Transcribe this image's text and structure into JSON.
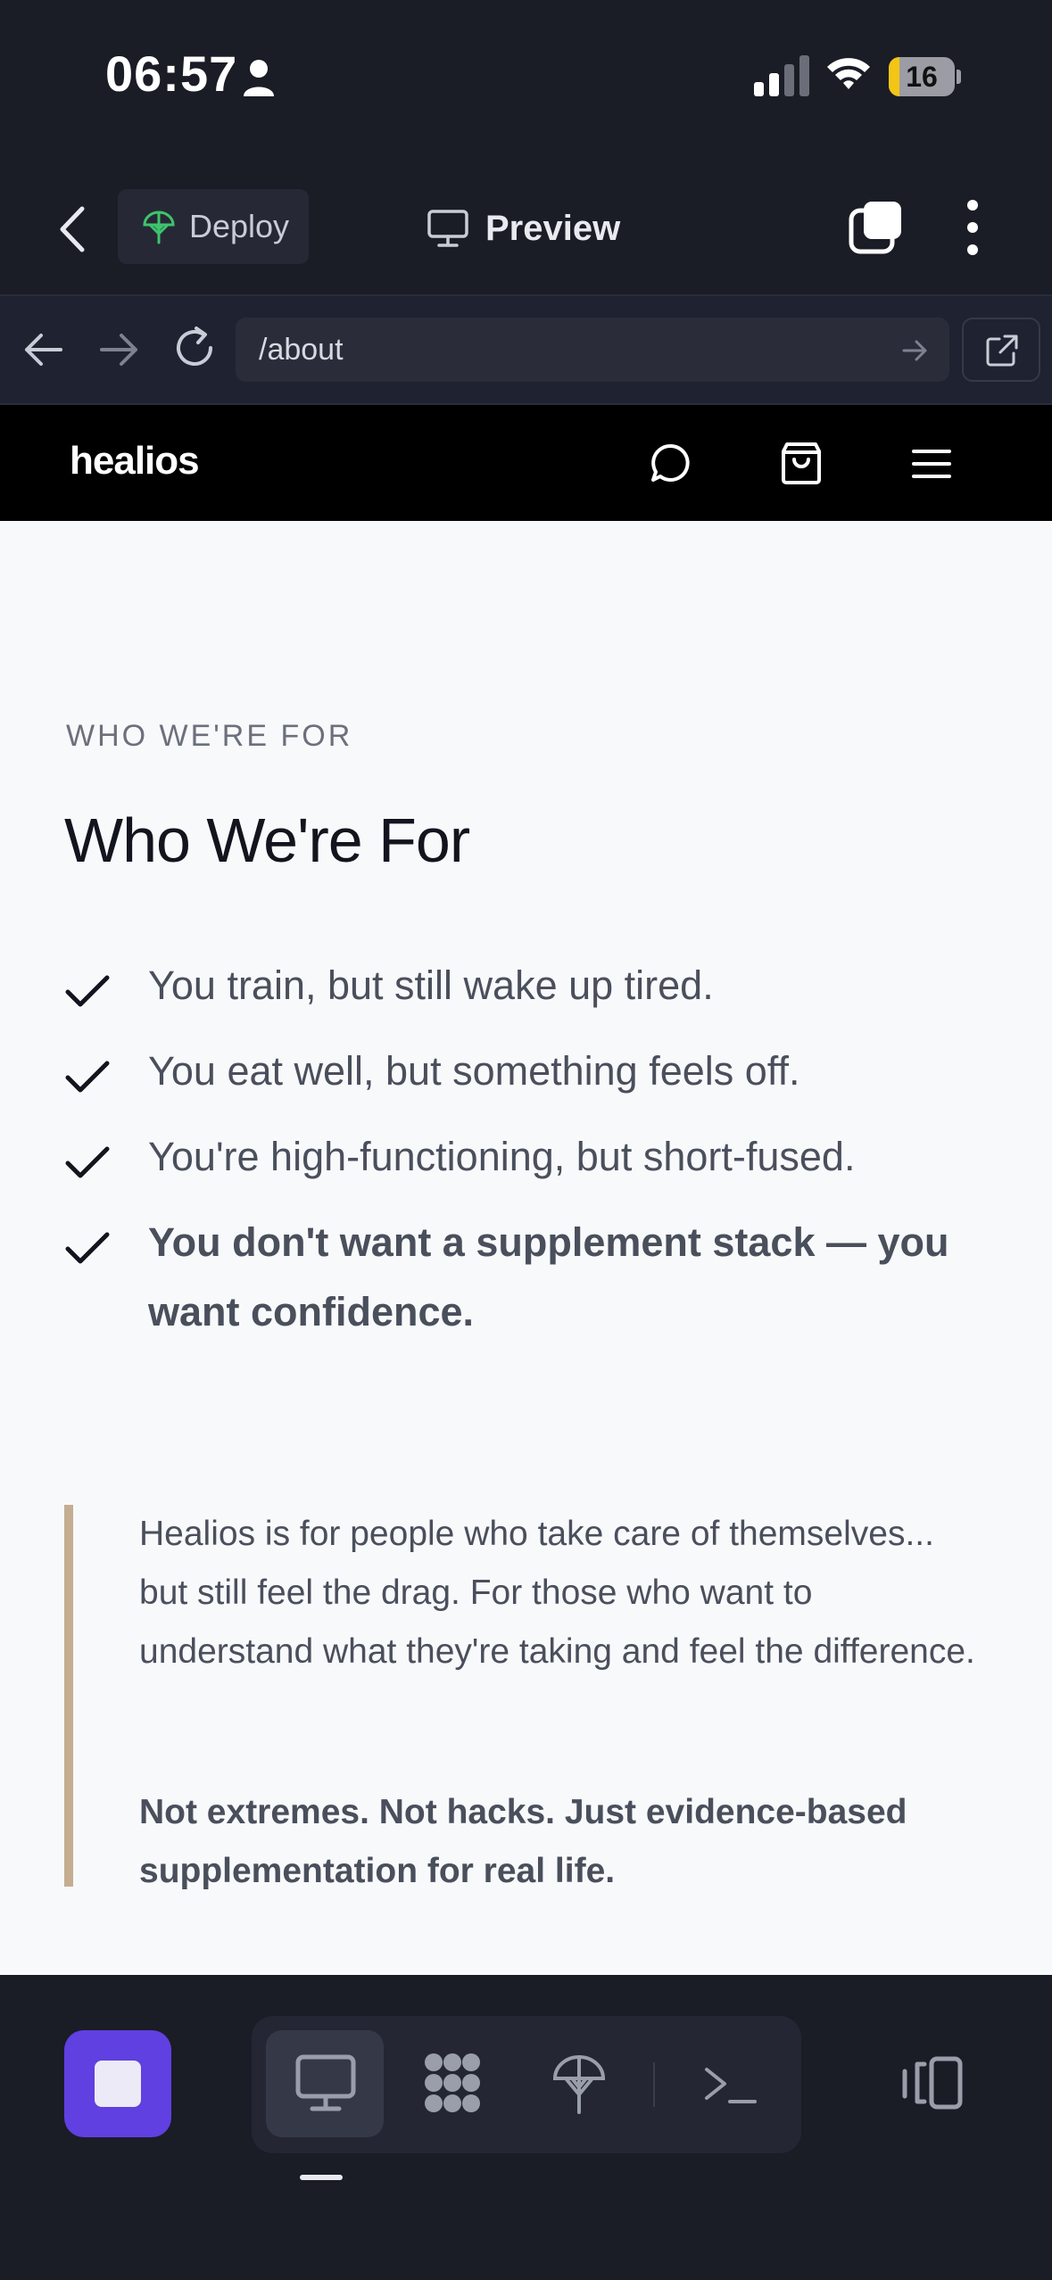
{
  "status_bar": {
    "time": "06:57",
    "battery": "16",
    "battery_level_percent": 16,
    "icons": [
      "person-icon",
      "signal-icon",
      "wifi-icon",
      "battery-icon"
    ]
  },
  "app_bar": {
    "deploy_label": "Deploy",
    "preview_label": "Preview",
    "icons": [
      "chevron-left-icon",
      "deploy-icon",
      "monitor-icon",
      "tabs-icon",
      "more-vertical-icon"
    ]
  },
  "url_bar": {
    "url": "/about",
    "icons": [
      "arrow-left-icon",
      "arrow-right-icon",
      "reload-icon",
      "go-arrow-icon",
      "external-link-icon"
    ]
  },
  "site_header": {
    "logo": "healios",
    "icons": [
      "chat-icon",
      "shopping-bag-icon",
      "menu-icon"
    ]
  },
  "content": {
    "eyebrow": "WHO WE'RE FOR",
    "heading": "Who We're For",
    "checklist": [
      "You train, but still wake up tired.",
      "You eat well, but something feels off.",
      "You're high-functioning, but short-fused.",
      "You don't want a supplement stack — you want confidence."
    ],
    "quote": {
      "paragraph1": "Healios is for people who take care of themselves... but still feel the drag. For those who want to understand what they're taking and feel the difference.",
      "paragraph2": "Not extremes. Not hacks. Just evidence-based supplementation for real life."
    }
  },
  "dock": {
    "icons": [
      "stop-icon",
      "monitor-icon",
      "apps-icon",
      "deploy-icon",
      "terminal-icon",
      "devices-icon"
    ]
  },
  "colors": {
    "chrome_bg": "#1a1c26",
    "site_header_bg": "#000000",
    "content_bg": "#f8f9fb",
    "accent_purple": "#6040e0",
    "quote_border": "#c4ad90",
    "battery_yellow": "#f3c515"
  }
}
